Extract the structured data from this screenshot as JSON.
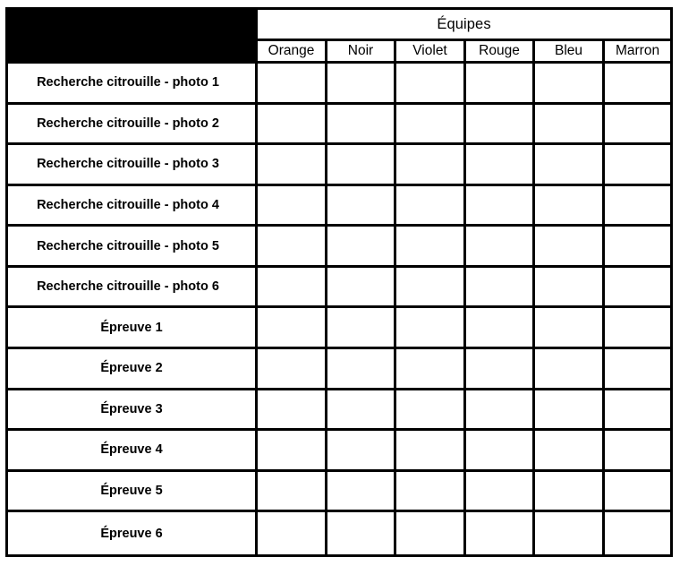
{
  "sheet": {
    "corner_block_label": "",
    "group_header": "Équipes",
    "teams": [
      "Orange",
      "Noir",
      "Violet",
      "Rouge",
      "Bleu",
      "Marron"
    ],
    "rows": [
      {
        "label": "Recherche citrouille - photo 1",
        "type": "photo",
        "scores": [
          "",
          "",
          "",
          "",
          "",
          ""
        ]
      },
      {
        "label": "Recherche citrouille - photo 2",
        "type": "photo",
        "scores": [
          "",
          "",
          "",
          "",
          "",
          ""
        ]
      },
      {
        "label": "Recherche citrouille - photo 3",
        "type": "photo",
        "scores": [
          "",
          "",
          "",
          "",
          "",
          ""
        ]
      },
      {
        "label": "Recherche citrouille - photo 4",
        "type": "photo",
        "scores": [
          "",
          "",
          "",
          "",
          "",
          ""
        ]
      },
      {
        "label": "Recherche citrouille - photo 5",
        "type": "photo",
        "scores": [
          "",
          "",
          "",
          "",
          "",
          ""
        ]
      },
      {
        "label": "Recherche citrouille - photo 6",
        "type": "photo",
        "scores": [
          "",
          "",
          "",
          "",
          "",
          ""
        ]
      },
      {
        "label": "Épreuve 1",
        "type": "epreuve",
        "scores": [
          "",
          "",
          "",
          "",
          "",
          ""
        ]
      },
      {
        "label": "Épreuve 2",
        "type": "epreuve",
        "scores": [
          "",
          "",
          "",
          "",
          "",
          ""
        ]
      },
      {
        "label": "Épreuve 3",
        "type": "epreuve",
        "scores": [
          "",
          "",
          "",
          "",
          "",
          ""
        ]
      },
      {
        "label": "Épreuve 4",
        "type": "epreuve",
        "scores": [
          "",
          "",
          "",
          "",
          "",
          ""
        ]
      },
      {
        "label": "Épreuve 5",
        "type": "epreuve",
        "scores": [
          "",
          "",
          "",
          "",
          "",
          ""
        ]
      },
      {
        "label": "Épreuve 6",
        "type": "epreuve",
        "scores": [
          "",
          "",
          "",
          "",
          "",
          ""
        ]
      }
    ]
  },
  "colors": {
    "grid_line": "#000000",
    "corner_fill": "#000000",
    "cell_fill": "#ffffff",
    "text": "#000000"
  }
}
